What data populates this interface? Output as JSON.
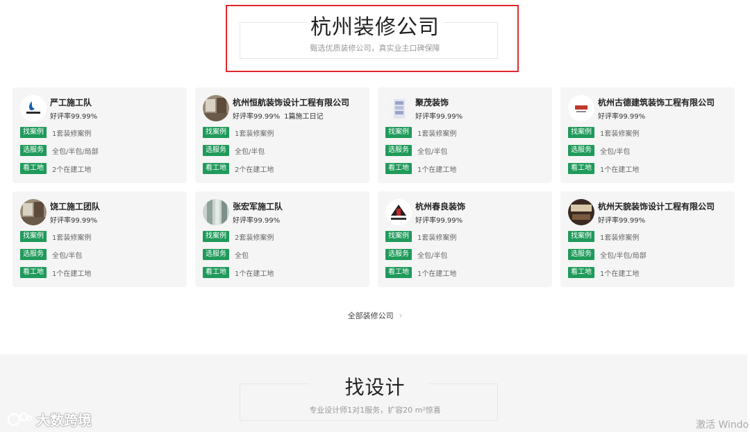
{
  "section1": {
    "title": "杭州装修公司",
    "subtitle": "甄选优质装修公司，真实业主口碑保障"
  },
  "companies": [
    {
      "name": "严工施工队",
      "rating": "好评率99.99%",
      "extra": "",
      "logo_icon": "company-logo-icon",
      "tags": [
        {
          "label": "找案例",
          "text": "1套装修案例"
        },
        {
          "label": "选服务",
          "text": "全包/半包/局部"
        },
        {
          "label": "看工地",
          "text": "2个在建工地"
        }
      ]
    },
    {
      "name": "杭州恒航装饰设计工程有限公司",
      "rating": "好评率99.99%",
      "extra": "1篇施工日记",
      "logo_icon": "room-photo-icon",
      "tags": [
        {
          "label": "找案例",
          "text": "1套装修案例"
        },
        {
          "label": "选服务",
          "text": "全包/半包"
        },
        {
          "label": "看工地",
          "text": "2个在建工地"
        }
      ]
    },
    {
      "name": "聚茂装饰",
      "rating": "好评率99.99%",
      "extra": "",
      "logo_icon": "cabinet-icon",
      "tags": [
        {
          "label": "找案例",
          "text": "1套装修案例"
        },
        {
          "label": "选服务",
          "text": "全包/半包"
        },
        {
          "label": "看工地",
          "text": "1个在建工地"
        }
      ]
    },
    {
      "name": "杭州古德建筑装饰工程有限公司",
      "rating": "好评率99.99%",
      "extra": "",
      "logo_icon": "brand-logo-icon",
      "tags": [
        {
          "label": "找案例",
          "text": "1套装修案例"
        },
        {
          "label": "选服务",
          "text": "全包/半包"
        },
        {
          "label": "看工地",
          "text": "1个在建工地"
        }
      ]
    },
    {
      "name": "饶工施工团队",
      "rating": "好评率99.99%",
      "extra": "",
      "logo_icon": "room-photo-icon",
      "tags": [
        {
          "label": "找案例",
          "text": "1套装修案例"
        },
        {
          "label": "选服务",
          "text": "全包/半包"
        },
        {
          "label": "看工地",
          "text": "1个在建工地"
        }
      ]
    },
    {
      "name": "张宏军施工队",
      "rating": "好评率99.99%",
      "extra": "",
      "logo_icon": "curtain-photo-icon",
      "tags": [
        {
          "label": "找案例",
          "text": "2套装修案例"
        },
        {
          "label": "选服务",
          "text": "全包"
        },
        {
          "label": "看工地",
          "text": "1个在建工地"
        }
      ]
    },
    {
      "name": "杭州春良装饰",
      "rating": "好评率99.99%",
      "extra": "",
      "logo_icon": "red-logo-icon",
      "tags": [
        {
          "label": "找案例",
          "text": "1套装修案例"
        },
        {
          "label": "选服务",
          "text": "全包/半包"
        },
        {
          "label": "看工地",
          "text": "1个在建工地"
        }
      ]
    },
    {
      "name": "杭州天貌装饰设计工程有限公司",
      "rating": "好评率99.99%",
      "extra": "",
      "logo_icon": "office-photo-icon",
      "tags": [
        {
          "label": "找案例",
          "text": "1套装修案例"
        },
        {
          "label": "选服务",
          "text": "全包/半包/局部"
        },
        {
          "label": "看工地",
          "text": "1个在建工地"
        }
      ]
    }
  ],
  "all_link": {
    "label": "全部装修公司",
    "icon": "chevron-right-icon"
  },
  "section2": {
    "title": "找设计",
    "subtitle": "专业设计师1对1服务，扩容20 m²惊喜"
  },
  "watermarks": {
    "left": "大数跨境",
    "right": "激活 Windo"
  },
  "colors": {
    "tag_green": "#1f9a5a",
    "highlight_red": "#e0282e",
    "card_bg": "#f5f5f5"
  }
}
